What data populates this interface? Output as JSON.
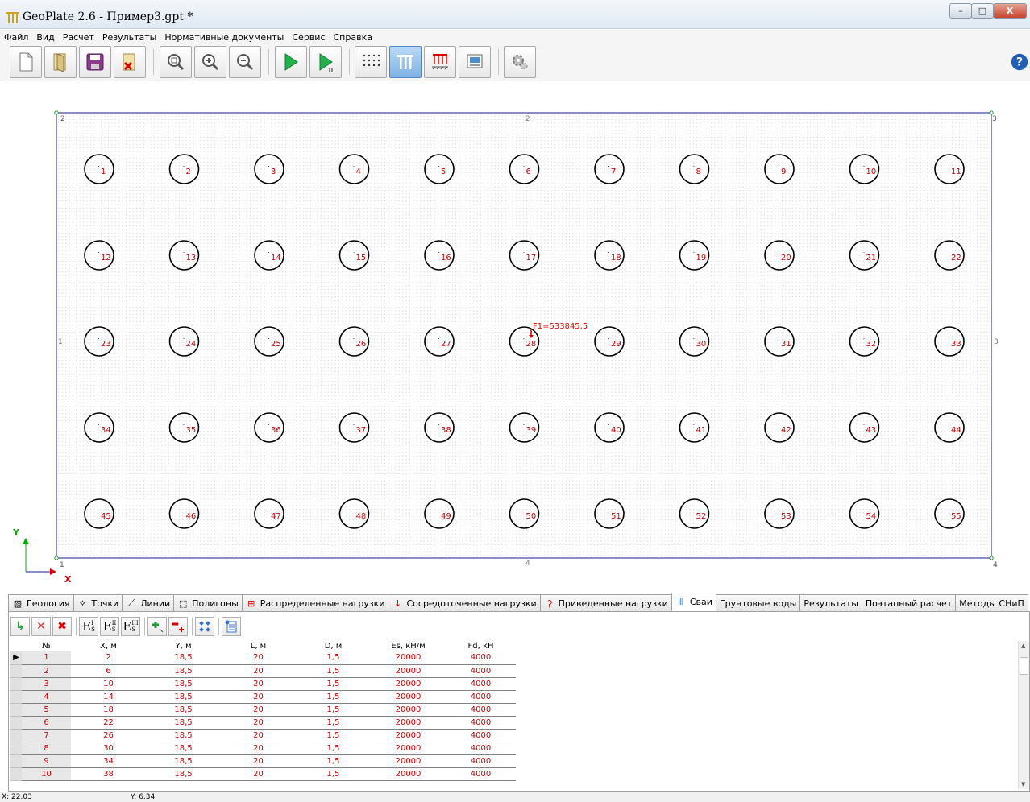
{
  "window": {
    "title": "GeoPlate 2.6  -  Пример3.gpt *",
    "min": "–",
    "max": "□",
    "close": "X"
  },
  "menu": [
    "Файл",
    "Вид",
    "Расчет",
    "Результаты",
    "Нормативные документы",
    "Сервис",
    "Справка"
  ],
  "toolbar": [
    {
      "name": "new-file-icon"
    },
    {
      "name": "open-file-icon"
    },
    {
      "name": "save-icon"
    },
    {
      "name": "close-file-icon"
    },
    {
      "name": "zoom-fit-icon"
    },
    {
      "name": "zoom-in-icon"
    },
    {
      "name": "zoom-out-icon"
    },
    {
      "name": "run-stage-1-icon"
    },
    {
      "name": "run-stage-2-icon"
    },
    {
      "name": "grid-points-icon"
    },
    {
      "name": "piles-icon"
    },
    {
      "name": "distributed-load-icon"
    },
    {
      "name": "results-view-icon"
    },
    {
      "name": "settings-icon"
    },
    {
      "name": "help-icon"
    }
  ],
  "canvas": {
    "corner_labels": [
      "2",
      "3",
      "1",
      "4"
    ],
    "edge_labels": [
      "2",
      "1",
      "3",
      "4"
    ],
    "pile_labels": [
      "1",
      "2",
      "3",
      "4",
      "5",
      "6",
      "7",
      "8",
      "9",
      "10",
      "11",
      "12",
      "13",
      "14",
      "15",
      "16",
      "17",
      "18",
      "19",
      "20",
      "21",
      "22",
      "23",
      "24",
      "25",
      "26",
      "27",
      "28",
      "29",
      "30",
      "31",
      "32",
      "33",
      "34",
      "35",
      "36",
      "37",
      "38",
      "39",
      "40",
      "41",
      "42",
      "43",
      "44",
      "45",
      "46",
      "47",
      "48",
      "49",
      "50",
      "51",
      "52",
      "53",
      "54",
      "55"
    ],
    "force_label": "F1=533845,5",
    "axis_x": "X",
    "axis_y": "Y",
    "colors": {
      "plate": "#1a1a8c",
      "pile": "#000000",
      "label": "#cc0000",
      "axis": "#00aa00"
    }
  },
  "tabs": [
    {
      "label": "Геология",
      "icon": "geology-icon"
    },
    {
      "label": "Точки",
      "icon": "points-icon"
    },
    {
      "label": "Линии",
      "icon": "lines-icon"
    },
    {
      "label": "Полигоны",
      "icon": "polygons-icon"
    },
    {
      "label": "Распределенные нагрузки",
      "icon": "distributed-load-icon"
    },
    {
      "label": "Сосредоточенные нагрузки",
      "icon": "point-load-icon"
    },
    {
      "label": "Приведенные нагрузки",
      "icon": "reduced-load-icon"
    },
    {
      "label": "Сваи",
      "icon": "piles-icon",
      "active": true
    },
    {
      "label": "Грунтовые воды",
      "icon": ""
    },
    {
      "label": "Результаты",
      "icon": ""
    },
    {
      "label": "Поэтапный расчет",
      "icon": ""
    },
    {
      "label": "Методы СНиП",
      "icon": ""
    }
  ],
  "panel_tools": {
    "accept": "↳",
    "cancel": "✕",
    "delete": "✖",
    "es1": "E",
    "es2": "E",
    "es3": "E",
    "es1_sup": "I",
    "es2_sup": "II",
    "es3_sup": "III",
    "es_sub": "S"
  },
  "table": {
    "columns": [
      "№",
      "X, м",
      "Y, м",
      "L, м",
      "D, м",
      "Es, кН/м",
      "Fd, кН"
    ],
    "rows": [
      [
        "1",
        "2",
        "18,5",
        "20",
        "1,5",
        "20000",
        "4000"
      ],
      [
        "2",
        "6",
        "18,5",
        "20",
        "1,5",
        "20000",
        "4000"
      ],
      [
        "3",
        "10",
        "18,5",
        "20",
        "1,5",
        "20000",
        "4000"
      ],
      [
        "4",
        "14",
        "18,5",
        "20",
        "1,5",
        "20000",
        "4000"
      ],
      [
        "5",
        "18",
        "18,5",
        "20",
        "1,5",
        "20000",
        "4000"
      ],
      [
        "6",
        "22",
        "18,5",
        "20",
        "1,5",
        "20000",
        "4000"
      ],
      [
        "7",
        "26",
        "18,5",
        "20",
        "1,5",
        "20000",
        "4000"
      ],
      [
        "8",
        "30",
        "18,5",
        "20",
        "1,5",
        "20000",
        "4000"
      ],
      [
        "9",
        "34",
        "18,5",
        "20",
        "1,5",
        "20000",
        "4000"
      ],
      [
        "10",
        "38",
        "18,5",
        "20",
        "1,5",
        "20000",
        "4000"
      ]
    ]
  },
  "status": {
    "x": "X: 22.03",
    "y": "Y: 6.34"
  }
}
